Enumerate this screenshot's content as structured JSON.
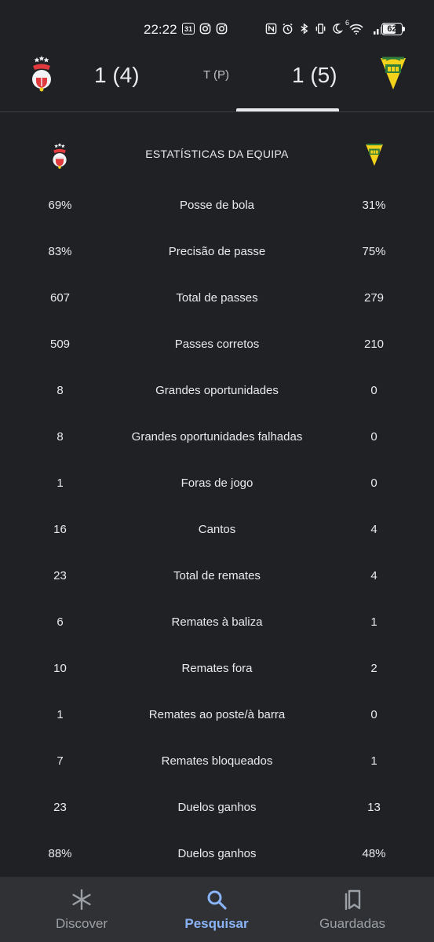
{
  "status_bar": {
    "time": "22:22",
    "calendar_day": "31",
    "network": "6",
    "battery": "62"
  },
  "match": {
    "home_score": "1 (4)",
    "status": "T (P)",
    "away_score": "1 (5)"
  },
  "stats": {
    "title": "ESTATÍSTICAS DA EQUIPA",
    "rows": [
      {
        "home": "69%",
        "label": "Posse de bola",
        "away": "31%"
      },
      {
        "home": "83%",
        "label": "Precisão de passe",
        "away": "75%"
      },
      {
        "home": "607",
        "label": "Total de passes",
        "away": "279"
      },
      {
        "home": "509",
        "label": "Passes corretos",
        "away": "210"
      },
      {
        "home": "8",
        "label": "Grandes oportunidades",
        "away": "0"
      },
      {
        "home": "8",
        "label": "Grandes oportunidades falhadas",
        "away": "0"
      },
      {
        "home": "1",
        "label": "Foras de jogo",
        "away": "0"
      },
      {
        "home": "16",
        "label": "Cantos",
        "away": "4"
      },
      {
        "home": "23",
        "label": "Total de remates",
        "away": "4"
      },
      {
        "home": "6",
        "label": "Remates à baliza",
        "away": "1"
      },
      {
        "home": "10",
        "label": "Remates fora",
        "away": "2"
      },
      {
        "home": "1",
        "label": "Remates ao poste/à barra",
        "away": "0"
      },
      {
        "home": "7",
        "label": "Remates bloqueados",
        "away": "1"
      },
      {
        "home": "23",
        "label": "Duelos ganhos",
        "away": "13"
      },
      {
        "home": "88%",
        "label": "Duelos ganhos",
        "away": "48%"
      }
    ]
  },
  "nav": {
    "discover": "Discover",
    "search": "Pesquisar",
    "saved": "Guardadas"
  },
  "colors": {
    "background": "#202124",
    "nav_background": "#303134",
    "accent": "#8ab4f8",
    "home_red": "#e03a3e",
    "away_yellow": "#f3d21b",
    "away_green": "#2f7d3a"
  }
}
